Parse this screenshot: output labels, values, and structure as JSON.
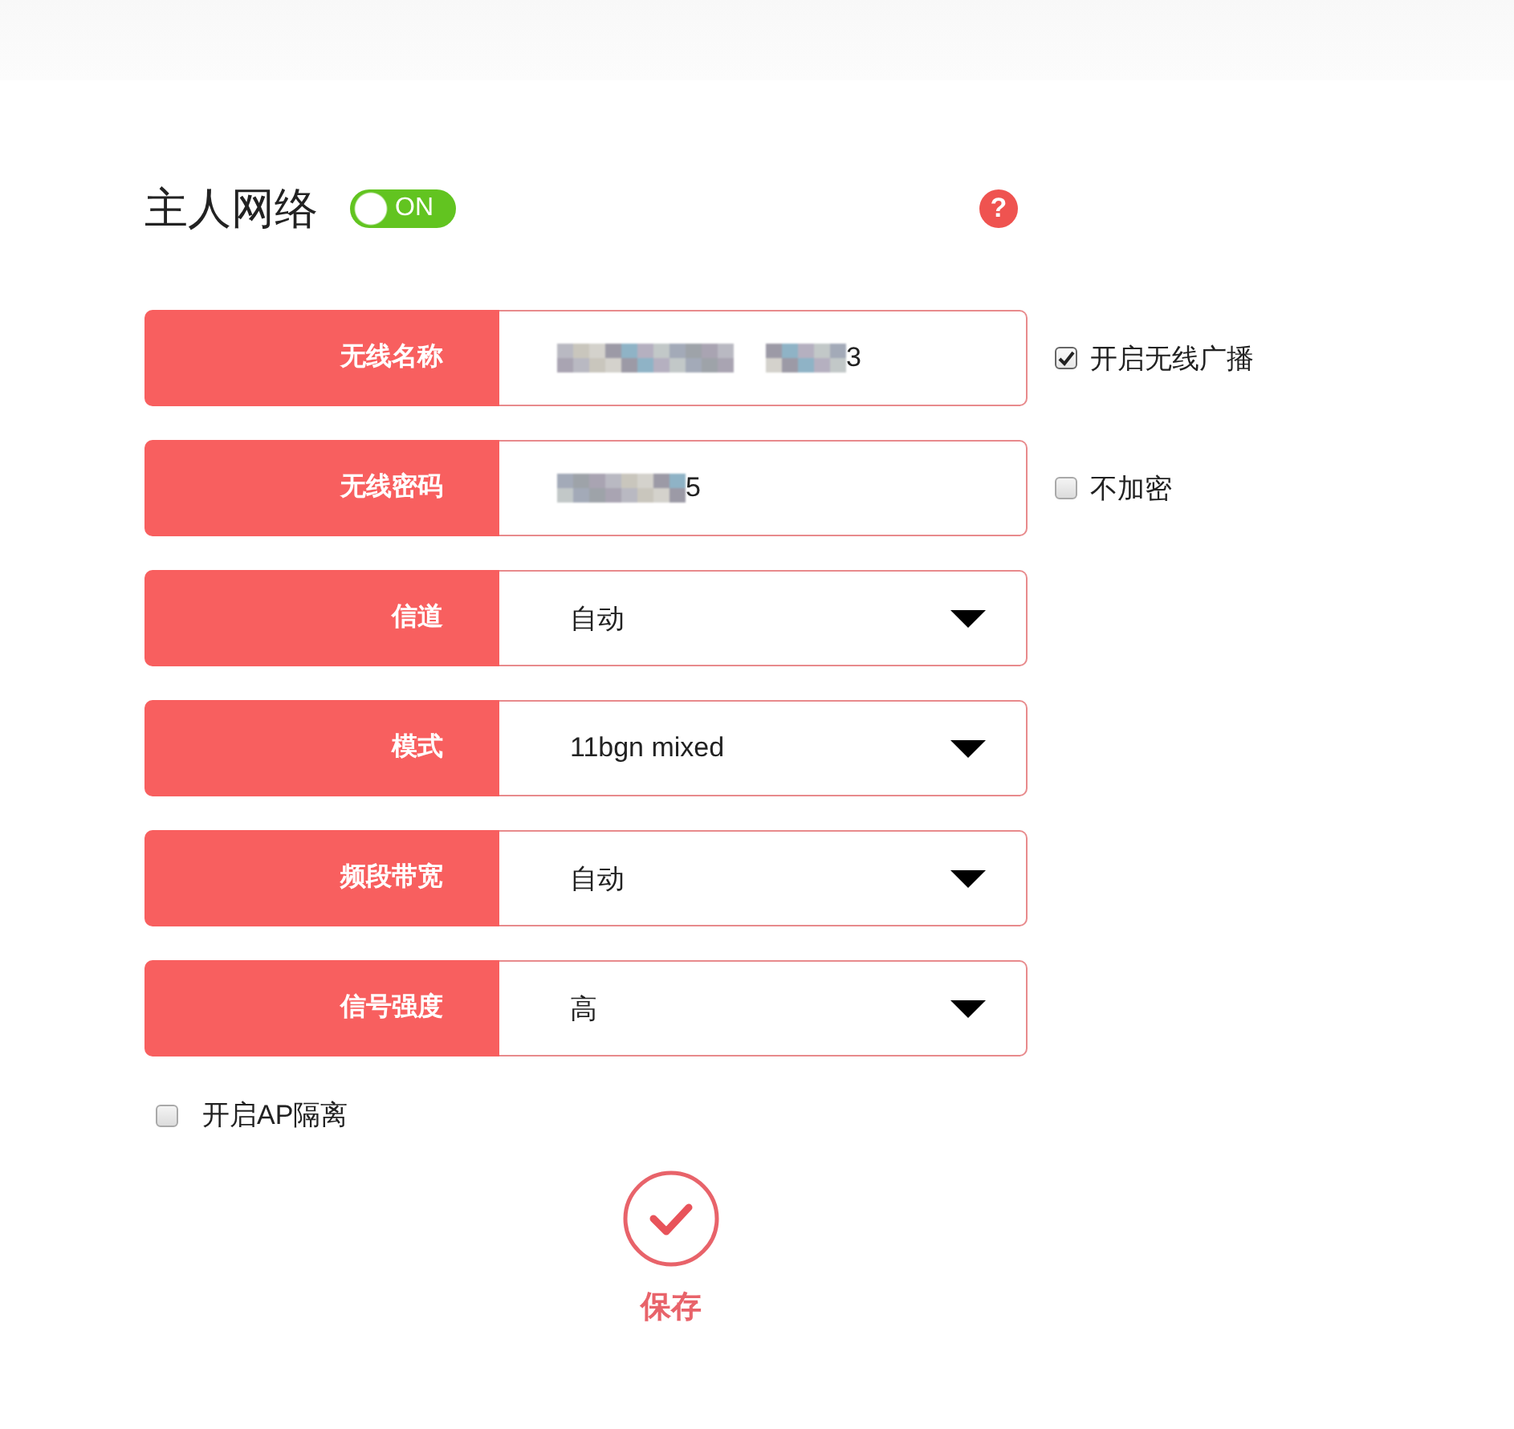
{
  "section": {
    "title": "主人网络",
    "toggle": {
      "on": true,
      "label": "ON"
    },
    "help": "?"
  },
  "fields": [
    {
      "kind": "text",
      "label": "无线名称",
      "value": "3",
      "redacted": true,
      "option": {
        "label": "开启无线广播",
        "checked": true
      }
    },
    {
      "kind": "text",
      "label": "无线密码",
      "value": "5",
      "redacted": true,
      "option": {
        "label": "不加密",
        "checked": false
      }
    },
    {
      "kind": "select",
      "label": "信道",
      "value": "自动"
    },
    {
      "kind": "select",
      "label": "模式",
      "value": "11bgn mixed"
    },
    {
      "kind": "select",
      "label": "频段带宽",
      "value": "自动"
    },
    {
      "kind": "select",
      "label": "信号强度",
      "value": "高"
    }
  ],
  "ap_isolation": {
    "label": "开启AP隔离",
    "checked": false
  },
  "save": {
    "label": "保存"
  }
}
